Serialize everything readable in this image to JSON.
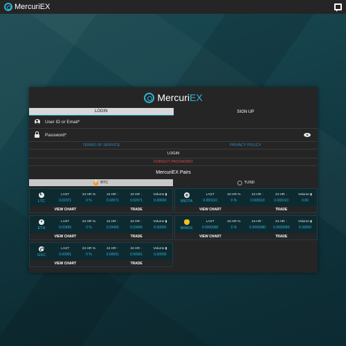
{
  "topbar": {
    "brand_name": "MercuriEX",
    "logo_icon": "mercuriex-logo-icon",
    "chat_icon": "chat-icon"
  },
  "panel": {
    "brand_prefix": "Mercuri",
    "brand_suffix": "EX",
    "tabs": [
      {
        "label": "LOGIN",
        "active": true
      },
      {
        "label": "SIGN UP",
        "active": false
      }
    ],
    "user_placeholder": "User ID or Email*",
    "password_placeholder": "Password*",
    "terms_label": "TERMS OF SERVICE",
    "privacy_label": "PRIVACY POLICY",
    "login_label": "LOGIN",
    "forgot_label": "FORGOT PASSWORD",
    "pairs_title": "MercuriEX Pairs"
  },
  "columns": [
    {
      "base": "BTC",
      "active": true,
      "coins": [
        {
          "symbol": "LTC",
          "icon": "litecoin-icon",
          "last": "0.02071",
          "change_pct": "0 %",
          "high": "0.02071",
          "low": "0.02071",
          "volume": "0.00000"
        },
        {
          "symbol": "ETH",
          "icon": "ethereum-icon",
          "last": "0.03455",
          "change_pct": "0 %",
          "high": "0.03455",
          "low": "0.03455",
          "volume": "0.00000"
        },
        {
          "symbol": "GXC",
          "icon": "gxchain-icon",
          "last": "0.00001",
          "change_pct": "0 %",
          "high": "0.00001",
          "low": "0.00001",
          "volume": "0.00000"
        }
      ]
    },
    {
      "base": "TUSD",
      "active": false,
      "coins": [
        {
          "symbol": "MIOTA",
          "icon": "iota-icon",
          "last": "0.000110",
          "change_pct": "0 %",
          "high": "0.000110",
          "low": "0.000110",
          "volume": "0.00"
        },
        {
          "symbol": "MINDS",
          "icon": "minds-bulb-icon",
          "last": "0.0000080",
          "change_pct": "0 %",
          "high": "0.0000080",
          "low": "0.0000080",
          "volume": "0.00000"
        }
      ]
    }
  ],
  "labels": {
    "last": "LAST",
    "change": "24 HR %",
    "high": "24 HR",
    "low": "24 HR",
    "volume": "Volume",
    "view_chart": "VIEW CHART",
    "trade": "TRADE"
  },
  "colors": {
    "accent": "#2bb6d6",
    "up": "#3fc46a",
    "down": "#e04848",
    "link": "#2e8bbf",
    "btc": "#f29a1e"
  }
}
